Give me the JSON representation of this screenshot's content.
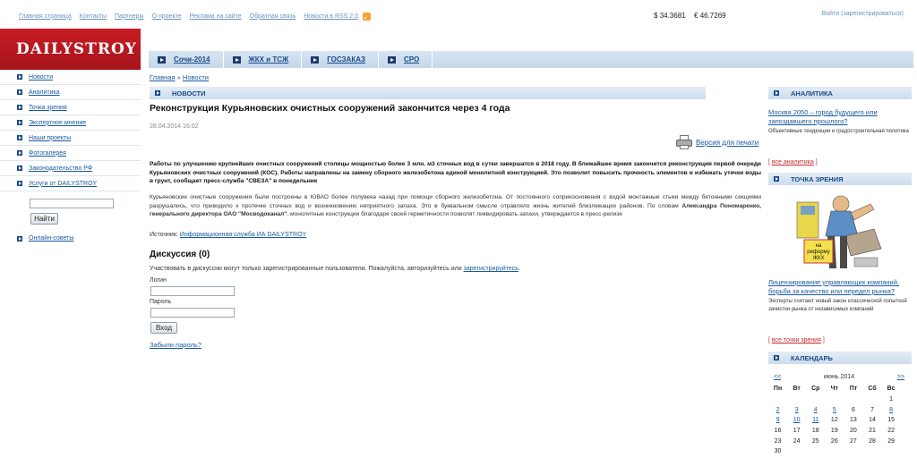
{
  "top_links": [
    "Главная страница",
    "Контакты",
    "Партнеры",
    "О проекте",
    "Реклама на сайте",
    "Обратная связь",
    "Новости в RSS 2.0"
  ],
  "currency": {
    "usd_symbol": "$",
    "usd": "34.3681",
    "eur_symbol": "€",
    "eur": "46.7269"
  },
  "login_top": "Войти (зарегистрироваться)",
  "logo": "DAILYSTROY",
  "top_nav": [
    "Сочи-2014",
    "ЖКХ и ТСЖ",
    "ГОСЗАКАЗ",
    "СРО"
  ],
  "sidebar": {
    "items": [
      "Новости",
      "Аналитика",
      "Точка зрения",
      "Экспертное мнение",
      "Наши проекты",
      "Фотогалерея",
      "Законодательство РФ",
      "Услуги от DAILYSTROY"
    ],
    "search_button": "Найти",
    "online": "Онлайн-советы"
  },
  "breadcrumb": {
    "home": "Главная",
    "sep": "»",
    "current": "Новости"
  },
  "section_title": "НОВОСТИ",
  "article": {
    "title": "Реконструкция Курьяновских очистных сооружений закончится через 4 года",
    "date": "28.04.2014 16:02",
    "print_label": "Версия для печати",
    "lead": "Работы по улучшению крупнейших очистных сооружений столицы мощностью более 3 млн. м3 сточных вод в сутки завершатся в 2018 году. В ближайшее время закончится реконструкция первой очереди Курьяновских очистных сооружений (КОС). Работы направлены на замену сборного железобетона единой монолитной конструкцией. Это позволит повысить прочность элементов и избежать утечки воды в грунт, сообщает пресс-служба \"СВЕЗА\" в понедельник",
    "body1": "Курьяновские очистные сооружения были построены в ЮВАО более полувека назад при помощи сборного железобетона. От постоянного соприкосновения с водой монтажные стыки между бетонными секциями разрушались, что приводило к протечке сточных вод и возникновению неприятного запаха. Это в буквальном смысле отравляло жизнь жителей близлежащих районов. По словам ",
    "body_bold": "Александра Пономаренко, генерального директора ОАО \"Мосводоканал\"",
    "body2": ", монолитные конструкции благодаря своей герметичности позволят ликвидировать запахи, утверждается в пресс-релизе",
    "source_label": "Источник:",
    "source_link": "Информационная служба ИА DAILYSTROY"
  },
  "discussion": {
    "title": "Дискуссия (0)",
    "text": "Участвовать в дискуссии могут только зарегистрированные пользователи. Пожалуйста, авторизуйтесь или ",
    "register_link": "зарегистрируйтесь",
    "login_label": "Логин",
    "password_label": "Пароль",
    "submit": "Вход",
    "forgot": "Забыли пароль?"
  },
  "right": {
    "analytics_title": "АНАЛИТИКА",
    "analytics_link": "Москва 2050 – город будущего или запоздавшего прошлого?",
    "analytics_desc": "Объективные тенденции и градостроительная политика",
    "analytics_all": "все аналитика",
    "viewpoint_title": "ТОЧКА ЗРЕНИЯ",
    "sign_text_1": "на",
    "sign_text_2": "реформу",
    "sign_text_3": "ЖКХ",
    "viewpoint_link": "Лицензирование управляющих компаний, борьба за качество или передел рынка?",
    "viewpoint_desc": "Эксперты считают новый закон классической попыткой зачистки рынка от независимых компаний",
    "viewpoint_all": "все точки зрения",
    "calendar_title": "КАЛЕНДАРЬ",
    "bracket_open": "[",
    "bracket_close": "]"
  },
  "calendar": {
    "prev": "<<",
    "next": ">>",
    "month": "июнь 2014",
    "weekdays": [
      "Пн",
      "Вт",
      "Ср",
      "Чт",
      "Пт",
      "Сб",
      "Вс"
    ],
    "weeks": [
      [
        "",
        "",
        "",
        "",
        "",
        "",
        "1"
      ],
      [
        "2",
        "3",
        "4",
        "5",
        "6",
        "7",
        "8"
      ],
      [
        "9",
        "10",
        "11",
        "12",
        "13",
        "14",
        "15"
      ],
      [
        "16",
        "17",
        "18",
        "19",
        "20",
        "21",
        "22"
      ],
      [
        "23",
        "24",
        "25",
        "26",
        "27",
        "28",
        "29"
      ],
      [
        "30",
        "",
        "",
        "",
        "",
        "",
        ""
      ]
    ],
    "linked_days": [
      "2",
      "3",
      "4",
      "5",
      "8",
      "9",
      "10",
      "11"
    ]
  }
}
